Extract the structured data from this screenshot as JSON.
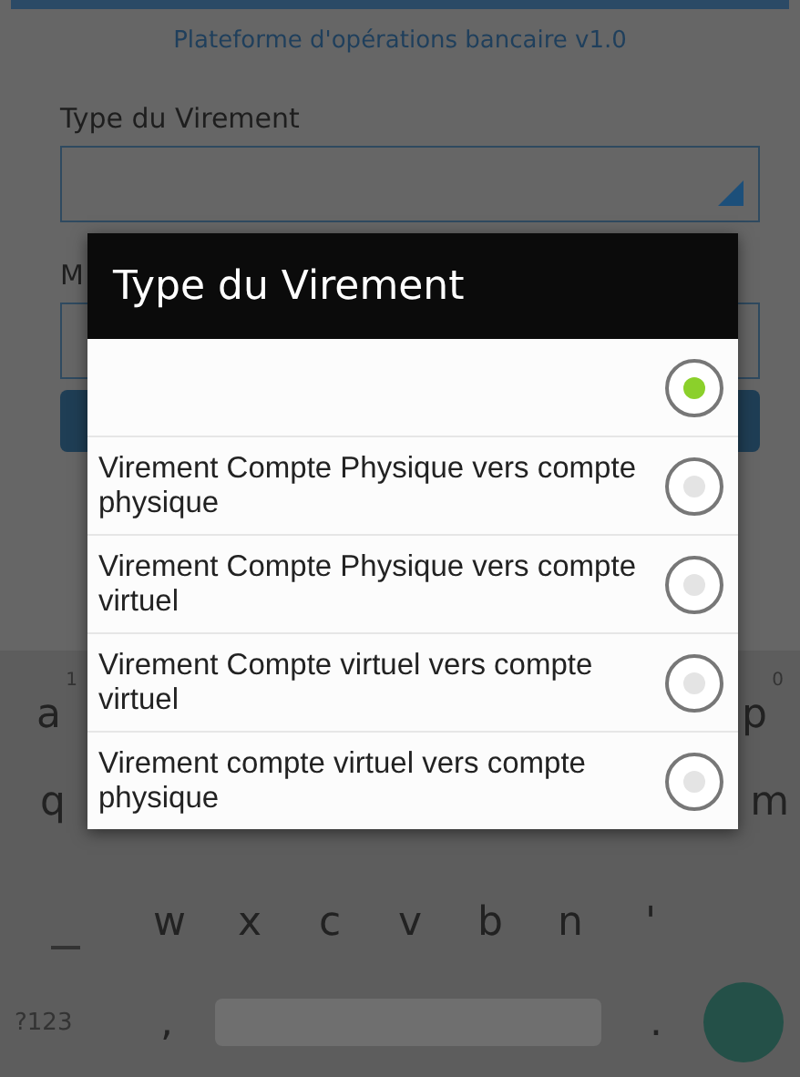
{
  "app": {
    "subtitle": "Plateforme d'opérations bancaire v1.0"
  },
  "form": {
    "fields": [
      {
        "label": "Type du Virement",
        "kind": "dropdown"
      },
      {
        "label": "M",
        "kind": "text"
      }
    ]
  },
  "dialog": {
    "title": "Type du Virement",
    "options": [
      {
        "selected": true
      },
      {
        "label": "Virement Compte Physique vers compte physique",
        "selected": false
      },
      {
        "label": "Virement Compte Physique vers compte virtuel",
        "selected": false
      },
      {
        "label": "Virement Compte virtuel vers compte virtuel",
        "selected": false
      },
      {
        "label": "Virement compte virtuel vers compte physique",
        "selected": false
      }
    ]
  },
  "keyboard": {
    "row_1": [
      {
        "key": "a",
        "hint": "1"
      },
      {
        "key": "p",
        "hint": "0"
      }
    ],
    "row_2": [
      {
        "key": "q"
      },
      {
        "key": "m"
      }
    ],
    "row_3": [
      {
        "key": "w"
      },
      {
        "key": "x"
      },
      {
        "key": "c"
      },
      {
        "key": "v"
      },
      {
        "key": "b"
      },
      {
        "key": "n"
      },
      {
        "key": "'"
      }
    ],
    "bottom": {
      "symbols_key": "?123",
      "comma_key": ",",
      "period_key": "."
    }
  }
}
